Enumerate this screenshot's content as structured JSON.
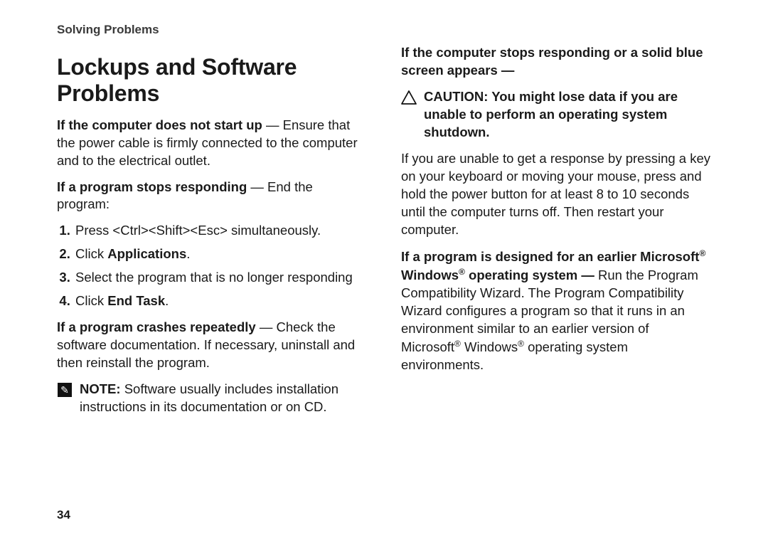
{
  "header": {
    "section": "Solving Problems"
  },
  "title": "Lockups and Software Problems",
  "left": {
    "p1_bold": "If the computer does not start up",
    "p1_rest": " — Ensure that the power cable is firmly connected to the computer and to the electrical outlet.",
    "p2_bold": "If a program stops responding",
    "p2_rest": " — End the program:",
    "steps": {
      "s1": "Press <Ctrl><Shift><Esc> simultaneously.",
      "s2_pre": "Click ",
      "s2_bold": "Applications",
      "s2_post": ".",
      "s3": "Select the program that is no longer responding",
      "s4_pre": "Click ",
      "s4_bold": "End Task",
      "s4_post": "."
    },
    "p3_bold": "If a program crashes repeatedly",
    "p3_rest": " — Check the software documentation. If necessary, uninstall and then reinstall the program.",
    "note_label": "NOTE:",
    "note_body": " Software usually includes installation instructions in its documentation or on CD."
  },
  "right": {
    "h1_bold": "If the computer stops responding or a solid blue screen appears —",
    "caution_bold": "CAUTION: You might lose data if you are unable to perform an operating system shutdown.",
    "p1": "If you are unable to get a response by pressing a key on your keyboard or moving your mouse, press and hold the power button for at least 8 to 10 seconds until the computer turns off. Then restart your computer.",
    "p2_bold_a": "If a program is designed for an earlier Microsoft",
    "p2_bold_b": " Windows",
    "p2_bold_c": " operating system — ",
    "p2_rest_a": "Run the Program Compatibility Wizard. The Program Compatibility Wizard configures a program so that it runs in an environment similar to an earlier version of Microsoft",
    "p2_rest_b": " Windows",
    "p2_rest_c": " operating system environments."
  },
  "page_number": "34",
  "reg_mark": "®"
}
